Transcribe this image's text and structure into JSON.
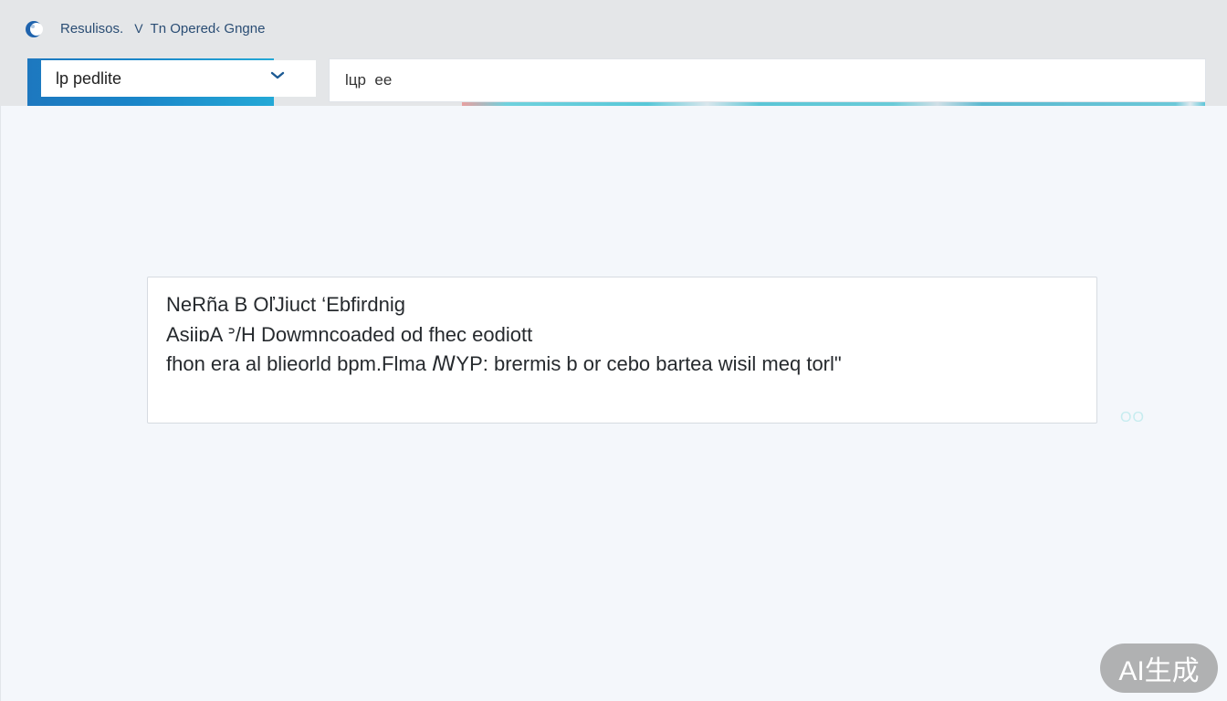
{
  "header": {
    "breadcrumb_root": "Resulisos.",
    "breadcrumb_separator": "V",
    "breadcrumb_current": "Tn Opered‹ Gngne"
  },
  "controls": {
    "select_value": "lp  pedlite",
    "search_value": "lцp  ee"
  },
  "message": {
    "lines": [
      "NeRña B OľJiuct ‘Ebfirdnig",
      "AsiiɒA  ᐣ/H Dowmncoaded od fhec eodiott",
      "fhon era al blieorld bpm.Flma ꟿYP: brermis b or cebo bartea wisil meq torl\""
    ]
  },
  "side_status": "OO",
  "watermark": "AI生成",
  "colors": {
    "accent": "#1d78bf",
    "accent_strip": "#5bc6d6",
    "breadcrumb_text": "#2a4d74"
  },
  "icons": {
    "logo": "app-logo-icon",
    "dropdown": "chevron-down-icon"
  }
}
